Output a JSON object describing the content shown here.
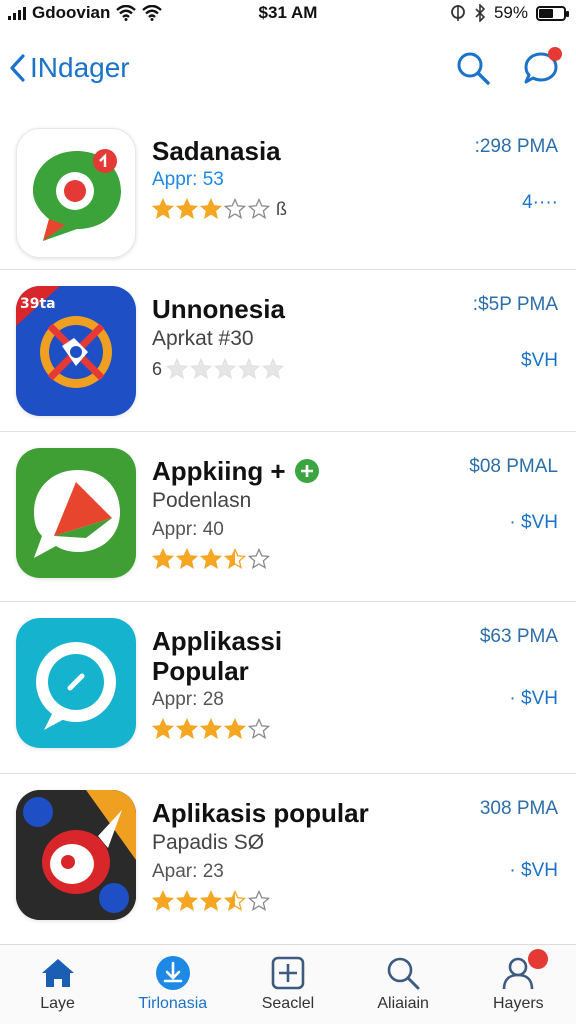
{
  "status_bar": {
    "carrier": "Gdoovian",
    "time": "$31 AM",
    "battery_pct": "59%",
    "battery_level": 0.59
  },
  "nav": {
    "back_label": "INdager"
  },
  "apps": [
    {
      "name": "Sadanasia",
      "subtitle": "",
      "meta": "Appr: 53",
      "meta_color": "#1e88e5",
      "rating": 3,
      "rating_tail": "ß",
      "time": ":298 PMA",
      "price": "4····",
      "icon": "chat-bubble-icon"
    },
    {
      "name": "Unnonesia",
      "subtitle": "Aprkat #30",
      "meta": "",
      "rating": 0,
      "rating_tail": "",
      "rating_prefix": "6",
      "time": ":$5P PMA",
      "price": "$VH",
      "icon": "game-emblem-icon"
    },
    {
      "name": "Appkiing +",
      "subtitle": "Podenlasn",
      "meta": "Appr: 40",
      "rating": 3.5,
      "rating_tail": "",
      "time": "$08 PMAL",
      "price": "· $VH",
      "icon": "message-bubble-icon"
    },
    {
      "name": "Applikassi Popular",
      "subtitle": "",
      "meta": "Appr: 28",
      "rating": 4,
      "rating_tail": "",
      "time": "$63 PMA",
      "price": "· $VH",
      "icon": "chat-circle-icon"
    },
    {
      "name": "Aplikasis popular",
      "subtitle": "Papadis SØ",
      "meta": "Apar: 23",
      "rating": 3.5,
      "rating_tail": "",
      "time": "308 PMA",
      "price": "· $VH",
      "icon": "mascot-game-icon"
    }
  ],
  "tabs": [
    {
      "label": "Laye",
      "icon": "home-icon",
      "active": false
    },
    {
      "label": "Tirlonasia",
      "icon": "download-icon",
      "active": true
    },
    {
      "label": "Seaclel",
      "icon": "add-box-icon",
      "active": false
    },
    {
      "label": "Aliaiain",
      "icon": "search-icon",
      "active": false
    },
    {
      "label": "Hayers",
      "icon": "profile-icon",
      "active": false
    }
  ],
  "colors": {
    "accent": "#1a73c8",
    "star": "#f5a623",
    "badge": "#e53935"
  }
}
